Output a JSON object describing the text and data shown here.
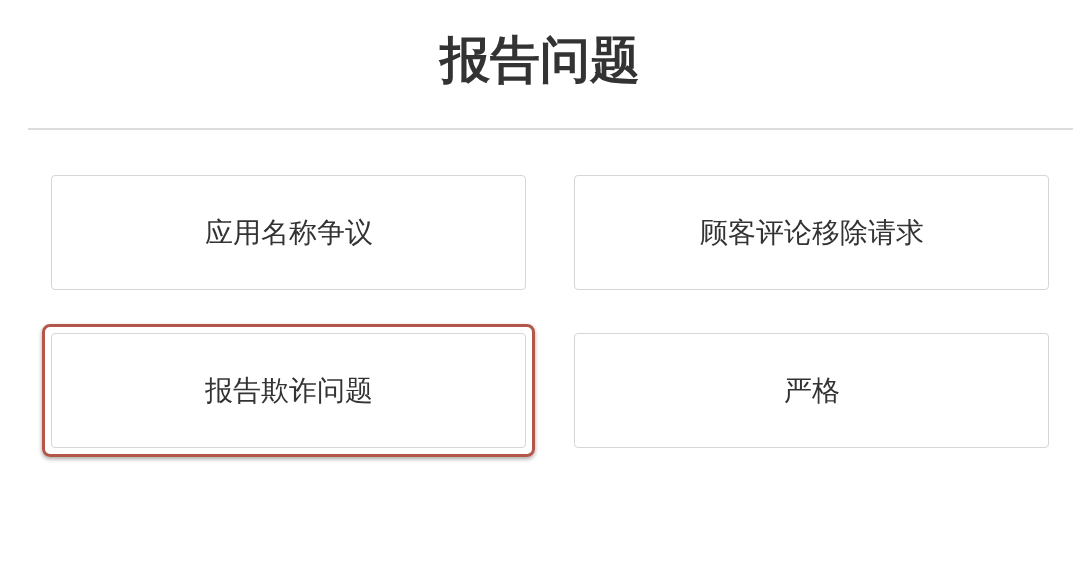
{
  "title": "报告问题",
  "options": [
    {
      "label": "应用名称争议",
      "highlighted": false
    },
    {
      "label": "顾客评论移除请求",
      "highlighted": false
    },
    {
      "label": "报告欺诈问题",
      "highlighted": true
    },
    {
      "label": "严格",
      "highlighted": false
    }
  ]
}
